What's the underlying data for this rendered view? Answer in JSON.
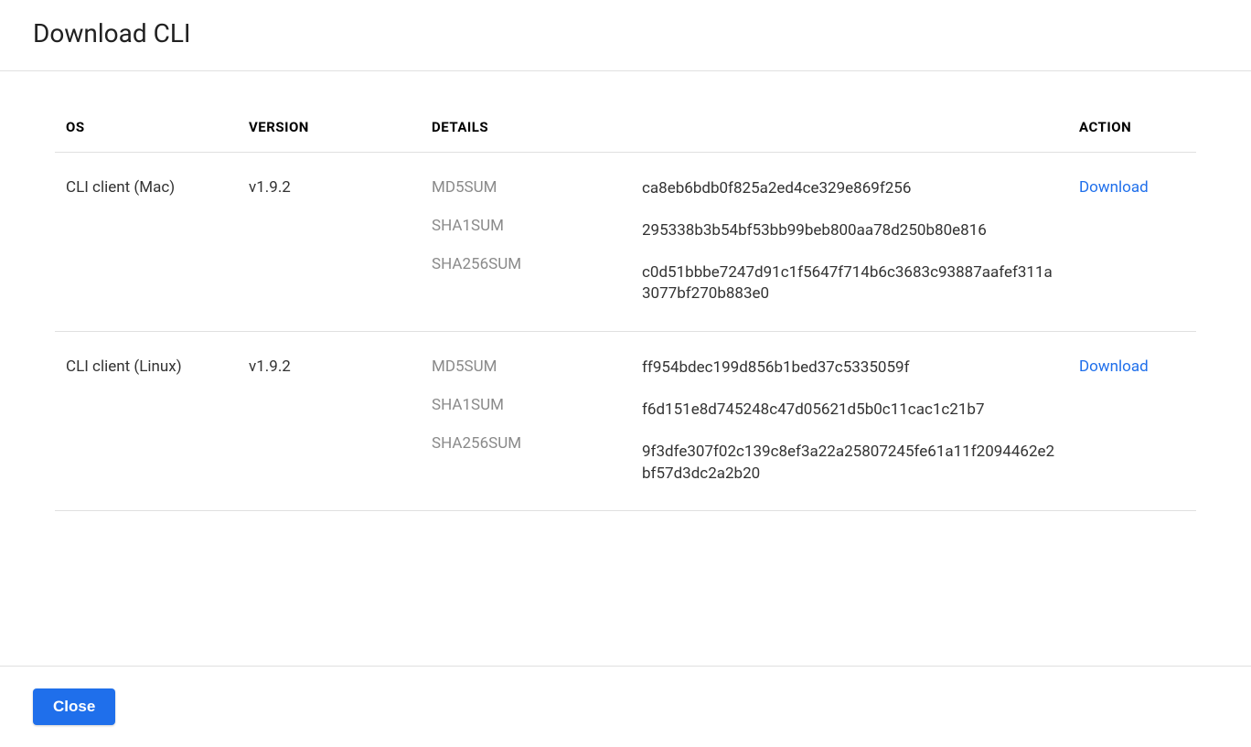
{
  "modal": {
    "title": "Download CLI",
    "close_label": "Close"
  },
  "table": {
    "headers": {
      "os": "OS",
      "version": "VERSION",
      "details": "DETAILS",
      "action": "ACTION"
    },
    "rows": [
      {
        "os": "CLI client (Mac)",
        "version": "v1.9.2",
        "checksums": [
          {
            "label": "MD5SUM",
            "value": "ca8eb6bdb0f825a2ed4ce329e869f256"
          },
          {
            "label": "SHA1SUM",
            "value": "295338b3b54bf53bb99beb800aa78d250b80e816"
          },
          {
            "label": "SHA256SUM",
            "value": "c0d51bbbe7247d91c1f5647f714b6c3683c93887aafef311a3077bf270b883e0"
          }
        ],
        "action_label": "Download"
      },
      {
        "os": "CLI client (Linux)",
        "version": "v1.9.2",
        "checksums": [
          {
            "label": "MD5SUM",
            "value": "ff954bdec199d856b1bed37c5335059f"
          },
          {
            "label": "SHA1SUM",
            "value": "f6d151e8d745248c47d05621d5b0c11cac1c21b7"
          },
          {
            "label": "SHA256SUM",
            "value": "9f3dfe307f02c139c8ef3a22a25807245fe61a11f2094462e2bf57d3dc2a2b20"
          }
        ],
        "action_label": "Download"
      }
    ]
  }
}
